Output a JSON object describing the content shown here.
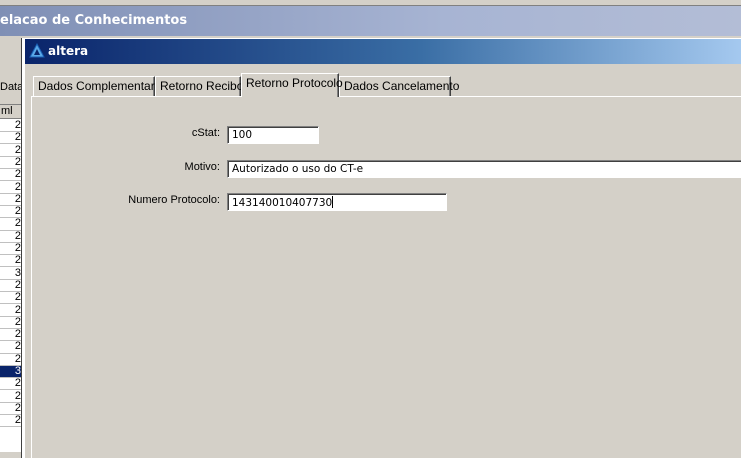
{
  "background_window": {
    "title": "elacao de Conhecimentos",
    "data_button_label": "Data",
    "grid_header": "ml",
    "grid_values": [
      "2",
      "2",
      "2",
      "2",
      "2",
      "2",
      "2",
      "2",
      "2",
      "2",
      "2",
      "2",
      "3",
      "2",
      "2",
      "2",
      "2",
      "2",
      "2",
      "2",
      "3",
      "2",
      "2",
      "2",
      "2"
    ],
    "selected_index": 20
  },
  "dialog": {
    "title": "altera",
    "tabs": [
      {
        "label": "Dados Complementares",
        "active": false
      },
      {
        "label": "Retorno Recibo",
        "active": false
      },
      {
        "label": "Retorno Protocolo",
        "active": true
      },
      {
        "label": "Dados Cancelamento",
        "active": false
      }
    ],
    "form": {
      "cstat_label": "cStat:",
      "cstat_value": "100",
      "motivo_label": "Motivo:",
      "motivo_value": "Autorizado o uso do CT-e",
      "protocolo_label": "Numero Protocolo:",
      "protocolo_value": "143140010407730"
    }
  },
  "colors": {
    "dialog_title_start": "#0a246a",
    "dialog_title_end": "#a6caf0",
    "face": "#d4d0c8",
    "selection": "#0a246a"
  },
  "icons": {
    "app_icon": "altera-triangle-icon"
  }
}
